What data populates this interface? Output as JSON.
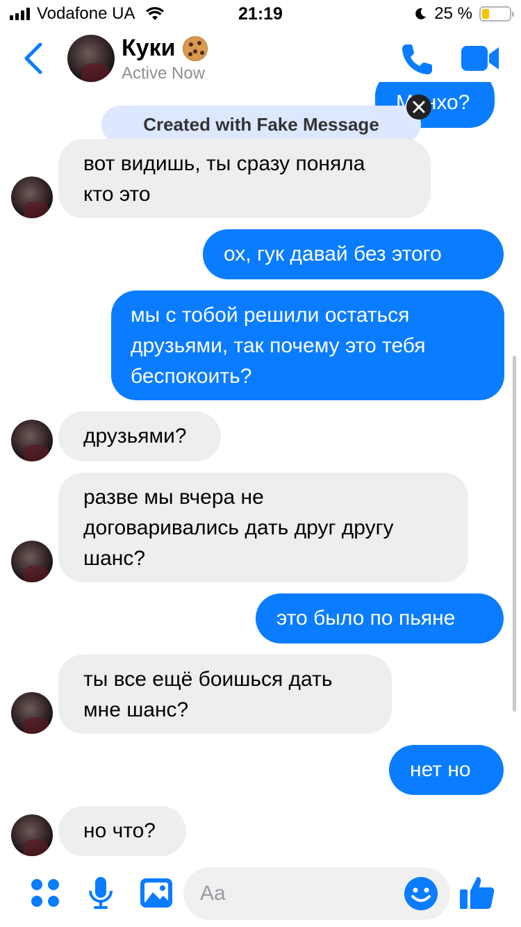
{
  "status_bar": {
    "carrier": "Vodafone UA",
    "time": "21:19",
    "battery_percent": "25 %",
    "battery_level": 0.25
  },
  "header": {
    "contact_name": "Куки",
    "status": "Active Now",
    "icons": [
      "back-icon",
      "cookie-emoji-icon",
      "phone-icon",
      "video-camera-icon"
    ]
  },
  "watermark": {
    "text": "Created with Fake Message"
  },
  "messages": [
    {
      "from": "me",
      "text": "Минхо?"
    },
    {
      "from": "them",
      "lines": [
        "вот видишь, ты сразу поняла",
        "кто это"
      ]
    },
    {
      "from": "me",
      "text": "ох, гук давай без этого"
    },
    {
      "from": "me",
      "lines": [
        "мы с тобой решили остаться",
        "друзьями, так почему это тебя",
        "беспокоить?"
      ]
    },
    {
      "from": "them",
      "text": "друзьями?"
    },
    {
      "from": "them",
      "lines": [
        "разве мы вчера не",
        "договаривались дать друг другу",
        "шанс?"
      ]
    },
    {
      "from": "me",
      "text": "это было по пьяне"
    },
    {
      "from": "them",
      "lines": [
        "ты все ещё боишься дать",
        "мне шанс?"
      ]
    },
    {
      "from": "me",
      "text": "нет но"
    },
    {
      "from": "them",
      "text": "но что?"
    }
  ],
  "composer": {
    "placeholder": "Aa",
    "icons": [
      "apps-icon",
      "microphone-icon",
      "image-icon",
      "emoji-icon",
      "thumbs-up-icon"
    ]
  },
  "colors": {
    "accent": "#0a7cff",
    "incoming_bubble": "#eeeeef",
    "watermark_bg": "#dde8ff",
    "battery": "#f5c400"
  }
}
